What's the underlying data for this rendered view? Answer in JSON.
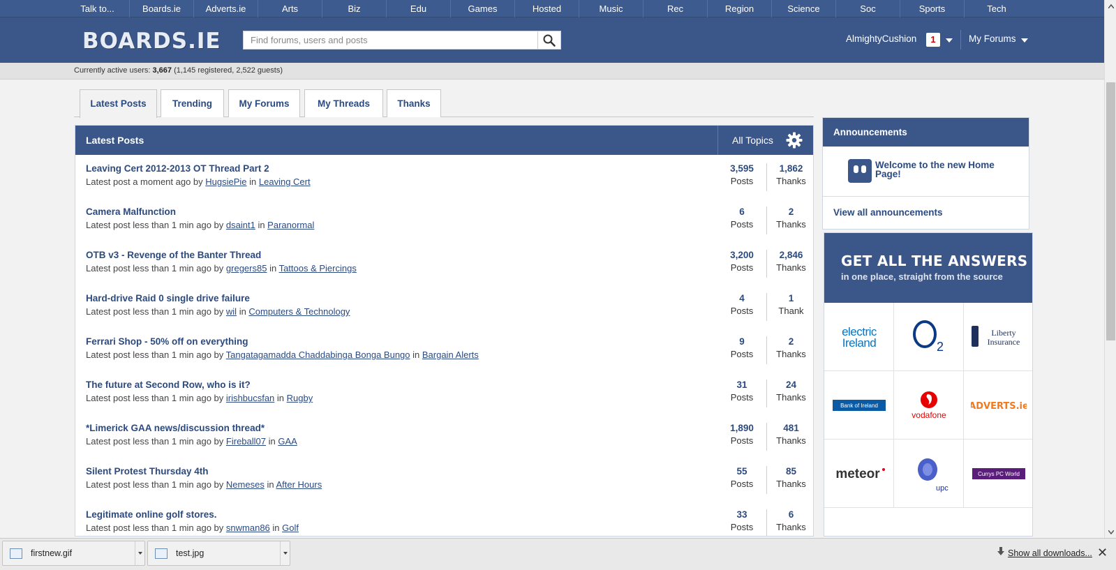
{
  "topnav": [
    "Talk to...",
    "Boards.ie",
    "Adverts.ie",
    "Arts",
    "Biz",
    "Edu",
    "Games",
    "Hosted",
    "Music",
    "Rec",
    "Region",
    "Science",
    "Soc",
    "Sports",
    "Tech"
  ],
  "header": {
    "logo": "BOARDS.IE",
    "search_placeholder": "Find forums, users and posts",
    "username": "AlmightyCushion",
    "notifications": "1",
    "my_forums": "My Forums"
  },
  "status": {
    "prefix": "Currently active users: ",
    "total": "3,667",
    "detail": " (1,145 registered, 2,522 guests)"
  },
  "tabs": [
    "Latest Posts",
    "Trending",
    "My Forums",
    "My Threads",
    "Thanks"
  ],
  "posts_panel": {
    "title": "Latest Posts",
    "filter": "All Topics",
    "rows": [
      {
        "title": "Leaving Cert 2012-2013 OT Thread Part 2",
        "time": "Latest post a moment ago by ",
        "user": "HugsiePie",
        "forum": "Leaving Cert",
        "posts": "3,595",
        "thanks": "1,862",
        "thanks_label": "Thanks"
      },
      {
        "title": "Camera Malfunction",
        "time": "Latest post less than 1 min ago by ",
        "user": "dsaint1",
        "forum": "Paranormal",
        "posts": "6",
        "thanks": "2",
        "thanks_label": "Thanks"
      },
      {
        "title": "OTB v3 - Revenge of the Banter Thread",
        "time": "Latest post less than 1 min ago by ",
        "user": "gregers85",
        "forum": "Tattoos & Piercings",
        "posts": "3,200",
        "thanks": "2,846",
        "thanks_label": "Thanks"
      },
      {
        "title": "Hard-drive Raid 0 single drive failure",
        "time": "Latest post less than 1 min ago by ",
        "user": "wil",
        "forum": "Computers & Technology",
        "posts": "4",
        "thanks": "1",
        "thanks_label": "Thank"
      },
      {
        "title": "Ferrari Shop - 50% off on everything",
        "time": "Latest post less than 1 min ago by ",
        "user": "Tangatagamadda Chaddabinga Bonga Bungo",
        "forum": "Bargain Alerts",
        "posts": "9",
        "thanks": "2",
        "thanks_label": "Thanks"
      },
      {
        "title": "The future at Second Row, who is it?",
        "time": "Latest post less than 1 min ago by ",
        "user": "irishbucsfan",
        "forum": "Rugby",
        "posts": "31",
        "thanks": "24",
        "thanks_label": "Thanks"
      },
      {
        "title": "*Limerick GAA news/discussion thread*",
        "time": "Latest post less than 1 min ago by ",
        "user": "Fireball07",
        "forum": "GAA",
        "posts": "1,890",
        "thanks": "481",
        "thanks_label": "Thanks"
      },
      {
        "title": "Silent Protest Thursday 4th",
        "time": "Latest post less than 1 min ago by ",
        "user": "Nemeses",
        "forum": "After Hours",
        "posts": "55",
        "thanks": "85",
        "thanks_label": "Thanks"
      },
      {
        "title": "Legitimate online golf stores.",
        "time": "Latest post less than 1 min ago by ",
        "user": "snwman86",
        "forum": "Golf",
        "posts": "33",
        "thanks": "6",
        "thanks_label": "Thanks"
      }
    ],
    "posts_label": "Posts",
    "in_word": " in "
  },
  "announcements": {
    "title": "Announcements",
    "item": "Welcome to the new Home Page!",
    "view_all": "View all announcements"
  },
  "advert": {
    "headline": "GET ALL THE ANSWERS",
    "sub": "in one place, straight from the source",
    "brands": [
      "electric Ireland",
      "O2",
      "Liberty Insurance",
      "Bank of Ireland",
      "vodafone",
      "ADVERTS.ie",
      "meteor",
      "upc",
      "Currys PC World"
    ]
  },
  "downloads": {
    "files": [
      "firstnew.gif",
      "test.jpg"
    ],
    "show_all": "Show all downloads..."
  },
  "colors": {
    "brand_blue": "#3b5689",
    "link": "#2b4a80",
    "badge_red": "#cc0000"
  }
}
